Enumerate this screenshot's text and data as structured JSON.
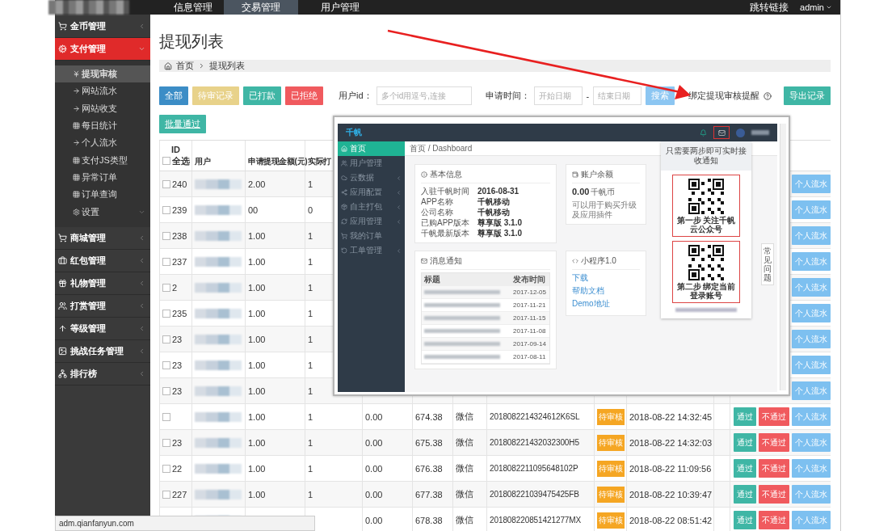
{
  "top_nav": {
    "items": [
      {
        "label": "信息管理",
        "selected": false
      },
      {
        "label": "交易管理",
        "selected": true
      },
      {
        "label": "用户管理",
        "selected": false
      }
    ],
    "link": "跳转链接",
    "user": "admin"
  },
  "sidebar": {
    "items": [
      {
        "label": "金币管理",
        "kind": "cart",
        "selected": false,
        "expanded": false
      },
      {
        "label": "支付管理",
        "kind": "gears",
        "selected": true,
        "expanded": true,
        "children": [
          {
            "label": "提现审核",
            "kind": "yen",
            "selected": true
          },
          {
            "label": "网站流水",
            "kind": "arrow",
            "selected": false
          },
          {
            "label": "网站收支",
            "kind": "arrow",
            "selected": false
          },
          {
            "label": "每日统计",
            "kind": "grid",
            "selected": false
          },
          {
            "label": "个人流水",
            "kind": "arrow",
            "selected": false
          },
          {
            "label": "支付JS类型",
            "kind": "grid",
            "selected": false
          },
          {
            "label": "异常订单",
            "kind": "grid",
            "selected": false
          },
          {
            "label": "订单查询",
            "kind": "grid",
            "selected": false
          },
          {
            "label": "设置",
            "kind": "gear",
            "selected": false,
            "submenu": true
          }
        ]
      },
      {
        "label": "商城管理",
        "kind": "cart",
        "selected": false,
        "expanded": false
      },
      {
        "label": "红包管理",
        "kind": "briefcase",
        "selected": false,
        "expanded": false
      },
      {
        "label": "礼物管理",
        "kind": "gift",
        "selected": false,
        "expanded": false
      },
      {
        "label": "打赏管理",
        "kind": "users",
        "selected": false,
        "expanded": false
      },
      {
        "label": "等级管理",
        "kind": "level",
        "selected": false,
        "expanded": false
      },
      {
        "label": "挑战任务管理",
        "kind": "picture",
        "selected": false,
        "expanded": false
      },
      {
        "label": "排行榜",
        "kind": "sitemap",
        "selected": false,
        "expanded": false
      }
    ]
  },
  "page_title": "提现列表",
  "breadcrumb": [
    "首页",
    "提现列表"
  ],
  "filters": {
    "buttons": [
      {
        "label": "全部",
        "kind": "primary"
      },
      {
        "label": "待审记录",
        "kind": "warning"
      },
      {
        "label": "已打款",
        "kind": "success"
      },
      {
        "label": "已拒绝",
        "kind": "danger"
      }
    ],
    "user_id": {
      "label": "用户id：",
      "placeholder": "多个id用逗号,连接"
    },
    "date": {
      "label": "申请时间：",
      "start_placeholder": "开始日期",
      "separator": "-",
      "end_placeholder": "结束日期"
    },
    "search_button": "搜索",
    "reminder_link": "绑定提现审核提醒",
    "export_button": "导出记录"
  },
  "batch_button": "批量通过",
  "table": {
    "header": {
      "id": "ID",
      "select_all": "全选",
      "select_all_checked": false,
      "user": "用户",
      "amount": "申请提现金额(元)",
      "column_4": "实际打"
    },
    "rows": [
      {
        "id": "240",
        "checked": false,
        "amount": "2.00",
        "column_4": "1",
        "actions": [
          {
            "label": "个人流水",
            "kind": "flow"
          }
        ]
      },
      {
        "id": "239",
        "checked": false,
        "amount": "00",
        "column_4": "0",
        "actions": [
          {
            "label": "个人流水",
            "kind": "flow"
          }
        ]
      },
      {
        "id": "238",
        "checked": false,
        "amount": "1.00",
        "column_4": "1",
        "actions": [
          {
            "label": "个人流水",
            "kind": "flow"
          }
        ]
      },
      {
        "id": "237",
        "checked": false,
        "amount": "1.00",
        "column_4": "1",
        "actions": [
          {
            "label": "个人流水",
            "kind": "flow"
          }
        ]
      },
      {
        "id": "2",
        "checked": false,
        "amount": "1.00",
        "column_4": "1",
        "actions": [
          {
            "label": "个人流水",
            "kind": "flow"
          }
        ]
      },
      {
        "id": "235",
        "checked": false,
        "amount": "1.00",
        "column_4": "1",
        "actions": [
          {
            "label": "个人流水",
            "kind": "flow"
          }
        ]
      },
      {
        "id": "23",
        "checked": false,
        "amount": "1.00",
        "column_4": "1",
        "actions": [
          {
            "label": "个人流水",
            "kind": "flow"
          }
        ]
      },
      {
        "id": "23",
        "checked": false,
        "amount": "1.00",
        "column_4": "1",
        "actions": [
          {
            "label": "个人流水",
            "kind": "flow"
          }
        ]
      },
      {
        "id": "23",
        "checked": false,
        "amount": "1.00",
        "column_4": "1",
        "actions": [
          {
            "label": "个人流水",
            "kind": "flow"
          }
        ]
      },
      {
        "checked": false,
        "amount": "1.00",
        "column_4": "1",
        "column_5": "0.00",
        "column_6": "674.38",
        "column_7": "微信",
        "column_8": "2018082214324612K6SL",
        "status": "待审核",
        "time": "2018-08-22 14:32:45",
        "actions": [
          {
            "label": "通过",
            "kind": "approve"
          },
          {
            "label": "不通过",
            "kind": "reject"
          },
          {
            "label": "个人流水",
            "kind": "flow"
          }
        ]
      },
      {
        "id": "23",
        "checked": false,
        "amount": "1.00",
        "column_4": "1",
        "column_5": "0.00",
        "column_6": "675.38",
        "column_7": "微信",
        "column_8": "201808221432032300H5",
        "status": "待审核",
        "time": "2018-08-22 14:32:03",
        "actions": [
          {
            "label": "通过",
            "kind": "approve"
          },
          {
            "label": "不通过",
            "kind": "reject"
          },
          {
            "label": "个人流水",
            "kind": "flow"
          }
        ]
      },
      {
        "id": "22",
        "checked": false,
        "amount": "1.00",
        "column_4": "1",
        "column_5": "0.00",
        "column_6": "676.38",
        "column_7": "微信",
        "column_8": "2018082211095648102P",
        "status": "待审核",
        "time": "2018-08-22 11:09:56",
        "actions": [
          {
            "label": "通过",
            "kind": "approve"
          },
          {
            "label": "不通过",
            "kind": "reject"
          },
          {
            "label": "个人流水",
            "kind": "flow"
          }
        ]
      },
      {
        "id": "227",
        "checked": false,
        "amount": "1.00",
        "column_4": "1",
        "column_5": "0.00",
        "column_6": "677.38",
        "column_7": "微信",
        "column_8": "201808221039475425FB",
        "status": "待审核",
        "time": "2018-08-22 10:39:47",
        "actions": [
          {
            "label": "通过",
            "kind": "approve"
          },
          {
            "label": "不通过",
            "kind": "reject"
          },
          {
            "label": "个人流水",
            "kind": "flow"
          }
        ]
      },
      {
        "column_5": "0.00",
        "column_6": "678.38",
        "column_7": "微信",
        "column_8": "201808220851421277MX",
        "status": "待审核",
        "time": "2018-08-22 08:51:42",
        "actions": [
          {
            "label": "通过",
            "kind": "approve"
          },
          {
            "label": "不通过",
            "kind": "reject"
          },
          {
            "label": "个人流水",
            "kind": "flow"
          }
        ]
      }
    ]
  },
  "embedded_screenshot": {
    "logo": "千帆",
    "sidebar": [
      {
        "label": "首页",
        "kind": "home",
        "selected": true
      },
      {
        "label": "用户管理",
        "kind": "users",
        "selected": false
      },
      {
        "label": "云数据",
        "kind": "cloud",
        "selected": false,
        "submenu": true
      },
      {
        "label": "应用配置",
        "kind": "share",
        "selected": false,
        "submenu": true
      },
      {
        "label": "自主打包",
        "kind": "package",
        "selected": false,
        "submenu": true
      },
      {
        "label": "应用管理",
        "kind": "refresh",
        "selected": false,
        "submenu": true
      },
      {
        "label": "我的订单",
        "kind": "cart",
        "selected": false
      },
      {
        "label": "工单管理",
        "kind": "undo",
        "selected": false,
        "submenu": true
      }
    ],
    "breadcrumb": "首页 / Dashboard",
    "basic_info": {
      "title": "基本信息",
      "rows": [
        {
          "label": "入驻千帆时间",
          "value": "2016-08-31"
        },
        {
          "label": "APP名称",
          "value": "千帆移动"
        },
        {
          "label": "公司名称",
          "value": "千帆移动"
        },
        {
          "label": "已购APP版本",
          "value": "尊享版 3.1.0"
        },
        {
          "label": "千帆最新版本",
          "value": "尊享版 3.1.0"
        }
      ]
    },
    "balance": {
      "title": "账户余额",
      "amount": "0.00",
      "unit": "千帆币",
      "note": "可以用于购买升级及应用插件"
    },
    "messages": {
      "title": "消息通知",
      "columns": [
        "标题",
        "发布时间"
      ],
      "rows": [
        {
          "date": "2017-12-05"
        },
        {
          "date": "2017-11-21"
        },
        {
          "date": "2017-11-15"
        },
        {
          "date": "2017-11-08"
        },
        {
          "date": "2017-09-14"
        },
        {
          "date": "2017-08-11"
        }
      ]
    },
    "mini_program": {
      "title": "小程序1.0",
      "links": [
        "下载",
        "帮助文档",
        "Demo地址"
      ]
    },
    "popup": {
      "heading": "只需要两步即可实时接收通知",
      "steps": [
        "第一步 关注千帆云公众号",
        "第二步 绑定当前登录账号"
      ]
    },
    "side_tab": "常见问题"
  },
  "status_bar": "adm.qianfanyun.com"
}
